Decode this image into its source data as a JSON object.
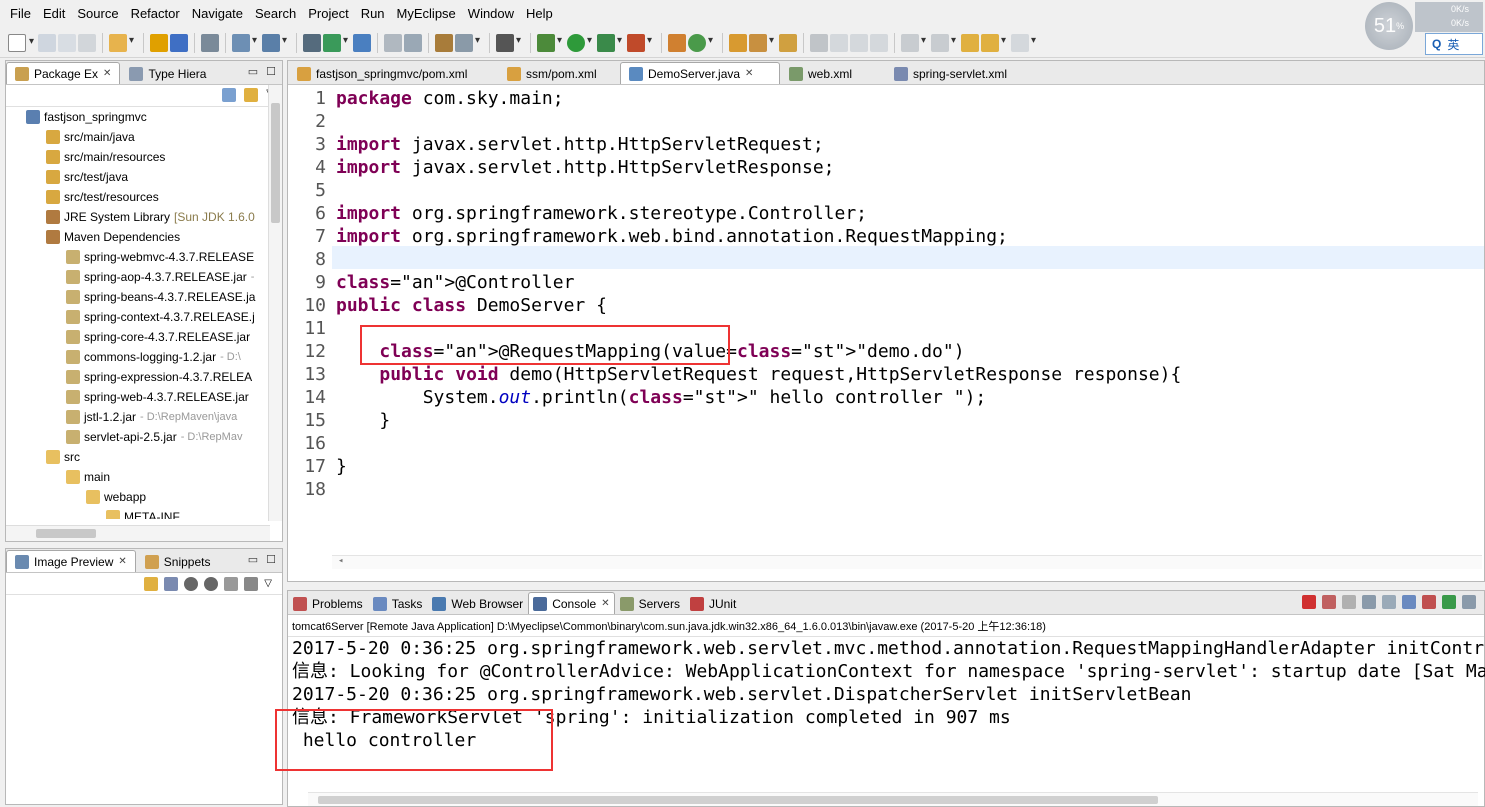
{
  "menu": [
    "File",
    "Edit",
    "Source",
    "Refactor",
    "Navigate",
    "Search",
    "Project",
    "Run",
    "MyEclipse",
    "Window",
    "Help"
  ],
  "cpu_usage": "51",
  "cpu_unit": "%",
  "net": [
    "0K/s",
    "0K/s"
  ],
  "ime": {
    "icon": "Q",
    "label": "英"
  },
  "package_view": {
    "tabs": [
      "Package Ex",
      "Type Hiera"
    ],
    "tree": [
      {
        "label": "fastjson_springmvc",
        "extra": "",
        "indent": 20,
        "icon": "project"
      },
      {
        "label": "src/main/java",
        "extra": "",
        "indent": 40,
        "icon": "folder"
      },
      {
        "label": "src/main/resources",
        "extra": "",
        "indent": 40,
        "icon": "folder"
      },
      {
        "label": "src/test/java",
        "extra": "",
        "indent": 40,
        "icon": "folder"
      },
      {
        "label": "src/test/resources",
        "extra": "",
        "indent": 40,
        "icon": "folder"
      },
      {
        "label": "JRE System Library",
        "extra": "[Sun JDK 1.6.0",
        "indent": 40,
        "icon": "lib"
      },
      {
        "label": "Maven Dependencies",
        "extra": "",
        "indent": 40,
        "icon": "lib"
      },
      {
        "label": "spring-webmvc-4.3.7.RELEASE",
        "extra": "",
        "indent": 60,
        "icon": "jar"
      },
      {
        "label": "spring-aop-4.3.7.RELEASE.jar",
        "extra": "-",
        "indent": 60,
        "icon": "jar"
      },
      {
        "label": "spring-beans-4.3.7.RELEASE.ja",
        "extra": "",
        "indent": 60,
        "icon": "jar"
      },
      {
        "label": "spring-context-4.3.7.RELEASE.j",
        "extra": "",
        "indent": 60,
        "icon": "jar"
      },
      {
        "label": "spring-core-4.3.7.RELEASE.jar",
        "extra": "",
        "indent": 60,
        "icon": "jar"
      },
      {
        "label": "commons-logging-1.2.jar",
        "extra": "- D:\\",
        "indent": 60,
        "icon": "jar"
      },
      {
        "label": "spring-expression-4.3.7.RELEA",
        "extra": "",
        "indent": 60,
        "icon": "jar"
      },
      {
        "label": "spring-web-4.3.7.RELEASE.jar",
        "extra": "",
        "indent": 60,
        "icon": "jar"
      },
      {
        "label": "jstl-1.2.jar",
        "extra": "- D:\\RepMaven\\java",
        "indent": 60,
        "icon": "jar"
      },
      {
        "label": "servlet-api-2.5.jar",
        "extra": "- D:\\RepMav",
        "indent": 60,
        "icon": "jar"
      },
      {
        "label": "src",
        "extra": "",
        "indent": 40,
        "icon": "openfolder"
      },
      {
        "label": "main",
        "extra": "",
        "indent": 60,
        "icon": "openfolder"
      },
      {
        "label": "webapp",
        "extra": "",
        "indent": 80,
        "icon": "openfolder"
      },
      {
        "label": "META-INF",
        "extra": "",
        "indent": 100,
        "icon": "openfolder"
      }
    ]
  },
  "image_view": {
    "tabs": [
      "Image Preview",
      "Snippets"
    ]
  },
  "editor": {
    "tabs": [
      "fastjson_springmvc/pom.xml",
      "ssm/pom.xml",
      "DemoServer.java",
      "web.xml",
      "spring-servlet.xml"
    ],
    "active_tab": 2,
    "lines": [
      "package com.sky.main;",
      "",
      "import javax.servlet.http.HttpServletRequest;",
      "import javax.servlet.http.HttpServletResponse;",
      "",
      "import org.springframework.stereotype.Controller;",
      "import org.springframework.web.bind.annotation.RequestMapping;",
      "",
      "@Controller",
      "public class DemoServer {",
      "",
      "    @RequestMapping(value=\"demo.do\")",
      "    public void demo(HttpServletRequest request,HttpServletResponse response){",
      "        System.out.println(\" hello controller \");",
      "    }",
      "",
      "}",
      ""
    ],
    "line_numbers": [
      "1",
      "2",
      "3",
      "4",
      "5",
      "6",
      "7",
      "8",
      "9",
      "10",
      "11",
      "12",
      "13",
      "14",
      "15",
      "16",
      "17",
      "18"
    ]
  },
  "console_view": {
    "tabs": [
      "Problems",
      "Tasks",
      "Web Browser",
      "Console",
      "Servers",
      "JUnit"
    ],
    "active_tab": 3,
    "header": "tomcat6Server [Remote Java Application] D:\\Myeclipse\\Common\\binary\\com.sun.java.jdk.win32.x86_64_1.6.0.013\\bin\\javaw.exe (2017-5-20 上午12:36:18)",
    "lines": [
      "2017-5-20 0:36:25 org.springframework.web.servlet.mvc.method.annotation.RequestMappingHandlerAdapter initContr",
      "信息: Looking for @ControllerAdvice: WebApplicationContext for namespace 'spring-servlet': startup date [Sat Ma",
      "2017-5-20 0:36:25 org.springframework.web.servlet.DispatcherServlet initServletBean",
      "信息: FrameworkServlet 'spring': initialization completed in 907 ms",
      " hello controller"
    ]
  },
  "colors": {
    "keyword": "#7f0055",
    "annotation": "#646464",
    "string": "#2a00ff",
    "highlight": "#e33333"
  }
}
